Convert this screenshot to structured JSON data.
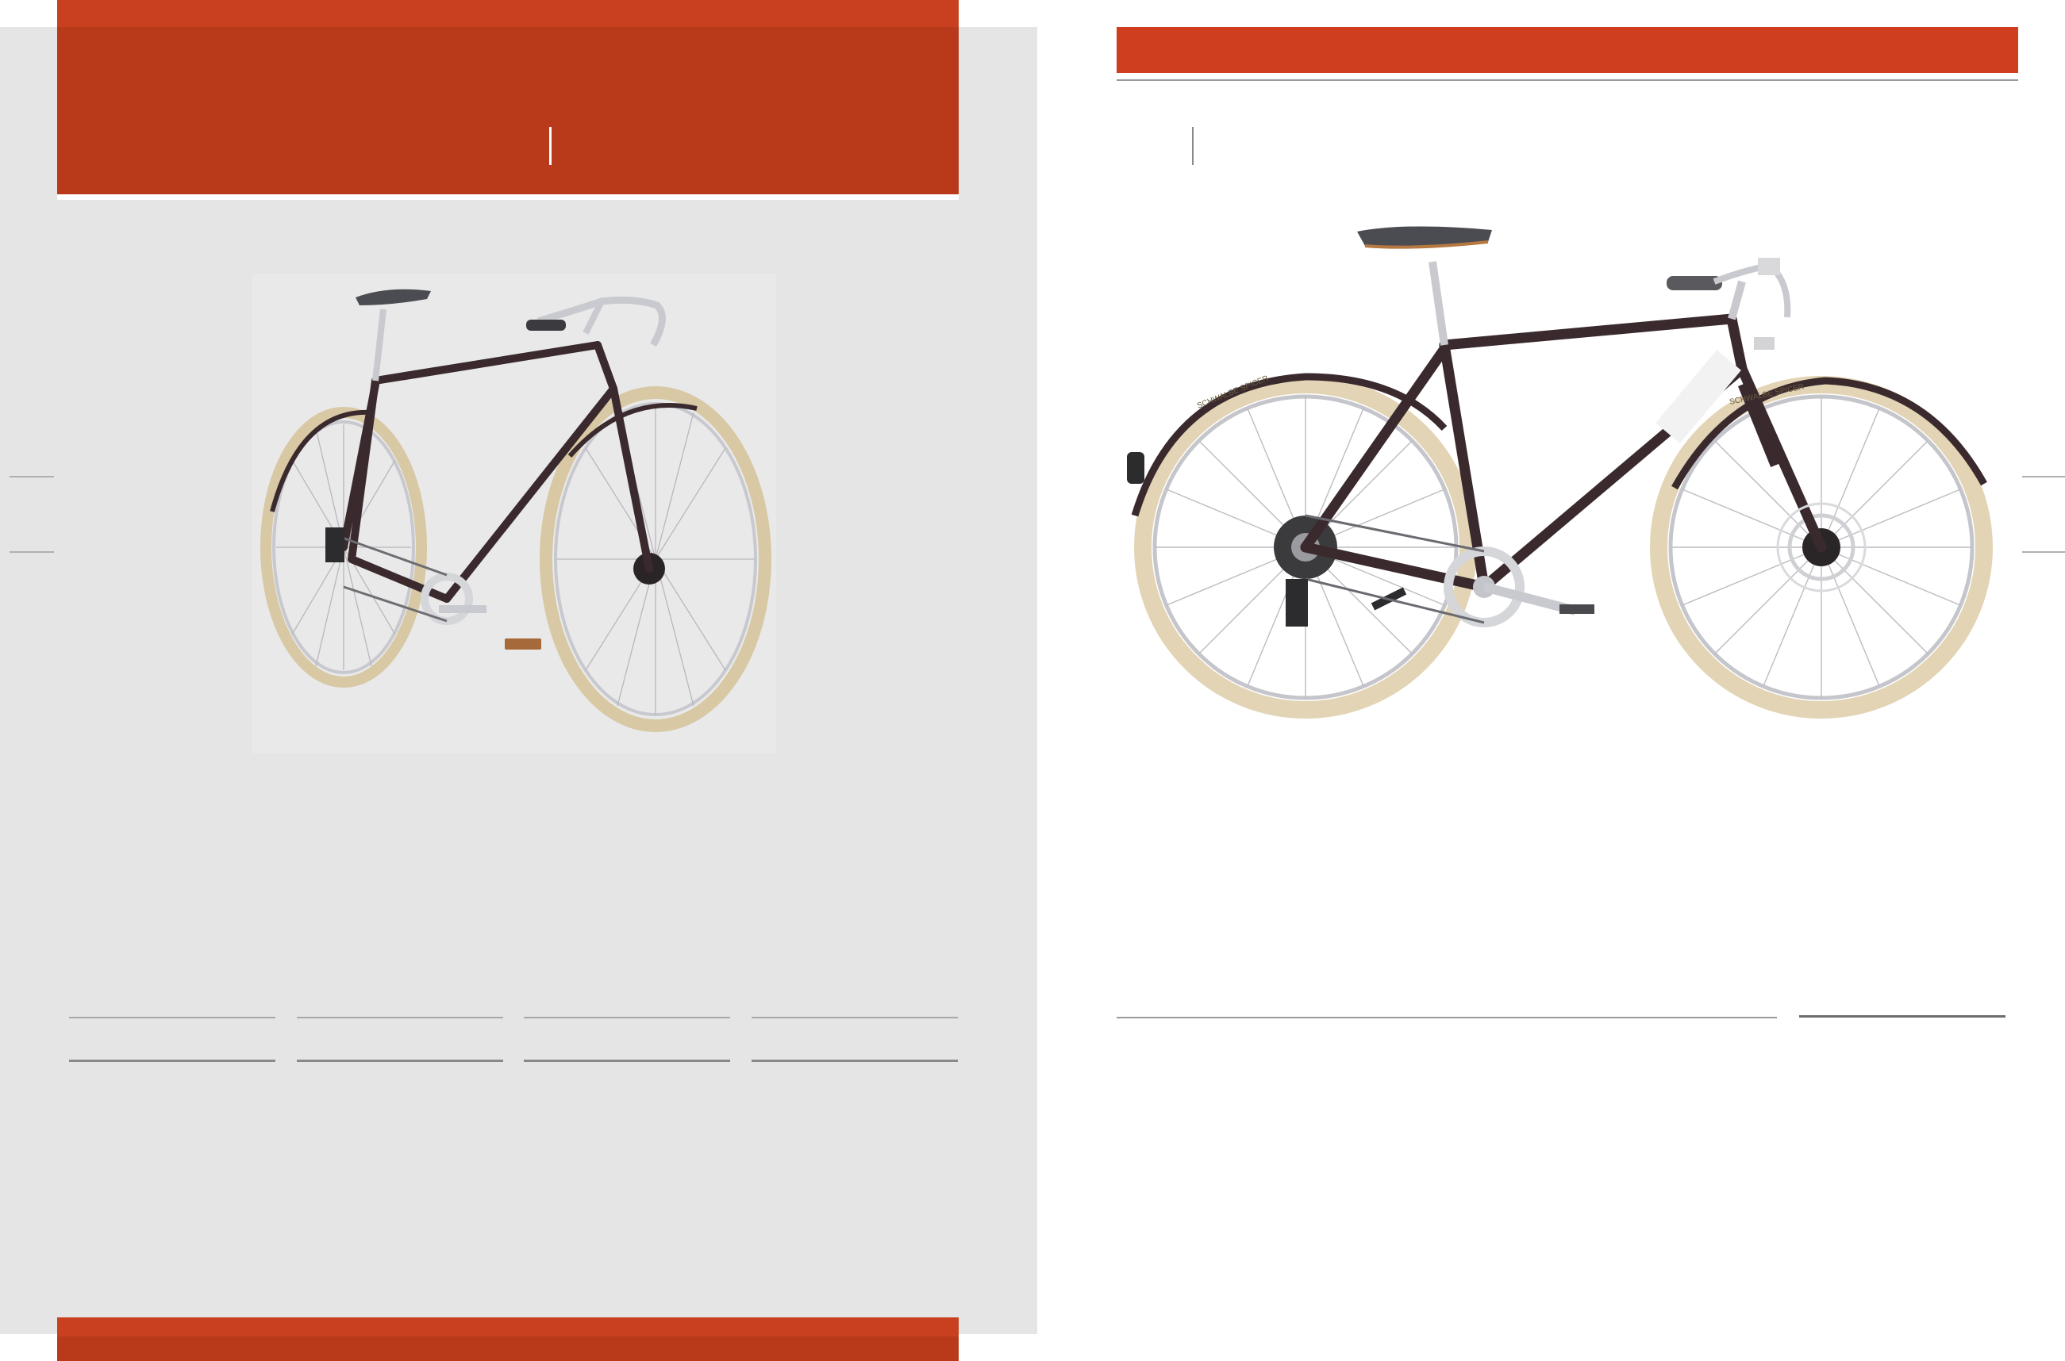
{
  "left_page": {
    "background": "#e5e5e6",
    "header_color": "#b9391b",
    "footer_color": "#b9391b",
    "image": "bike-three-quarter-view",
    "spec_columns": 4
  },
  "right_page": {
    "header_color": "#cf3e1e",
    "image": "bike-side-view"
  },
  "bike": {
    "frame_color": "#3a2a2e",
    "tire_color": "#e8dcc0",
    "tire_text": "SCHWALBE   SPICER"
  }
}
